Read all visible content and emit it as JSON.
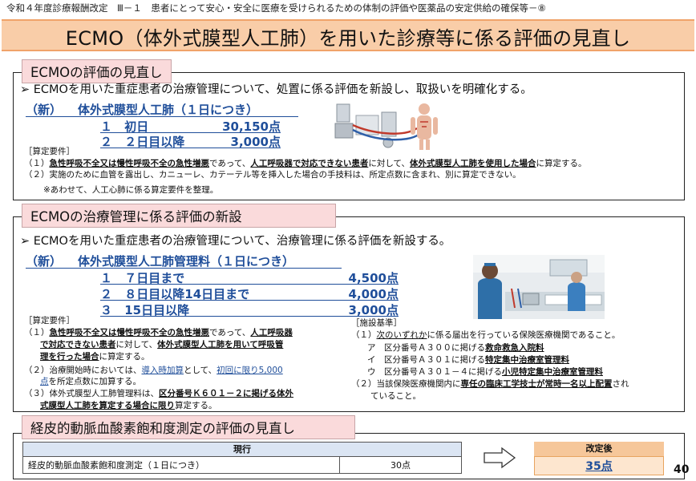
{
  "header": {
    "text": "令和４年度診療報酬改定　Ⅲ－１　患者にとって安心・安全に医療を受けられるための体制の評価や医薬品の安定供給の確保等－⑧"
  },
  "title": "ECMO（体外式膜型人工肺）を用いた診療等に係る評価の見直し",
  "section1": {
    "tab": "ECMOの評価の見直し",
    "bullet": "ECMOを用いた重症患者の治療管理について、処置に係る評価を新設し、取扱いを明確化する。",
    "heading_new": "（新）",
    "heading_name": "体外式膜型人工肺（１日につき）",
    "items": [
      {
        "no": "１",
        "label": "初日",
        "points": "30,150点"
      },
      {
        "no": "２",
        "label": "２日目以降",
        "points": "3,000点"
      }
    ],
    "req_title": "［算定要件］",
    "req1_a": "（１）",
    "req1_b": "急性呼吸不全又は慢性呼吸不全の急性増悪",
    "req1_c": "であって、",
    "req1_d": "人工呼吸器で対応できない患者",
    "req1_e": "に対して、",
    "req1_f": "体外式膜型人工肺を使用した場合",
    "req1_g": "に算定する。",
    "req2": "（２）実施のために血管を露出し、カニューレ、カテーテル等を挿入した場合の手技料は、所定点数に含まれ、別に算定できない。",
    "note": "※あわせて、人工心肺に係る算定要件を整理。"
  },
  "section2": {
    "tab": "ECMOの治療管理に係る評価の新設",
    "bullet": "ECMOを用いた重症患者の治療管理について、治療管理に係る評価を新設する。",
    "heading_new": "（新）",
    "heading_name": "体外式膜型人工肺管理料（１日につき）",
    "items": [
      {
        "no": "１",
        "label": "７日目まで",
        "points": "4,500点"
      },
      {
        "no": "２",
        "label": "８日目以降14日目まで",
        "points": "4,000点"
      },
      {
        "no": "３",
        "label": "15日目以降",
        "points": "3,000点"
      }
    ],
    "req_title": "［算定要件］",
    "req1_l1a": "（１）",
    "req1_l1b": "急性呼吸不全又は慢性呼吸不全の急性増悪",
    "req1_l1c": "であって、",
    "req1_l1d": "人工呼吸器",
    "req1_l2a": "で対応できない患者",
    "req1_l2b": "に対して、",
    "req1_l2c": "体外式膜型人工肺を用いて呼吸管",
    "req1_l3a": "理を行った場合",
    "req1_l3b": "に算定する。",
    "req2_l1a": "（２）治療開始時においては、",
    "req2_l1b": "導入時加算",
    "req2_l1c": "として、",
    "req2_l1d": "初回に限り5,000",
    "req2_l2a": "点",
    "req2_l2b": "を所定点数に加算する。",
    "req3_l1a": "（３）体外式膜型人工肺管理料は、",
    "req3_l1b": "区分番号Ｋ６０１－２に掲げる体外",
    "req3_l2a": "式膜型人工肺を算定する場合に限り",
    "req3_l2b": "算定する。",
    "facility_title": "［施設基準］",
    "fac1_a": "（１）",
    "fac1_b": "次のいずれか",
    "fac1_c": "に係る届出を行っている保険医療機関であること。",
    "fac_a_pre": "ア　区分番号Ａ３００に掲げる",
    "fac_a_u": "救命救急入院料",
    "fac_i_pre": "イ　区分番号Ａ３０１に掲げる",
    "fac_i_u": "特定集中治療室管理料",
    "fac_u_pre": "ウ　区分番号Ａ３０１－４に掲げる",
    "fac_u_u": "小児特定集中治療室管理料",
    "fac2_a": "（２）当該保険医療機関内に",
    "fac2_b": "専任の臨床工学技士が常時一名以上配置",
    "fac2_c": "され",
    "fac2_d": "ていること。"
  },
  "section3": {
    "tab": "経皮的動脈血酸素飽和度測定の評価の見直し",
    "current_header": "現行",
    "row_label": "経皮的動脈血酸素飽和度測定（１日につき）",
    "row_value": "30点",
    "revised_header": "改定後",
    "revised_value": "35点"
  },
  "page_number": "40",
  "colors": {
    "title_banner": "#f9cda8",
    "section_tab": "#fadadb",
    "blue_text": "#1f4e9a",
    "table_header": "#dbe5f3",
    "revised_header": "#f6c79a",
    "revised_value_bg": "#fde6cf"
  }
}
